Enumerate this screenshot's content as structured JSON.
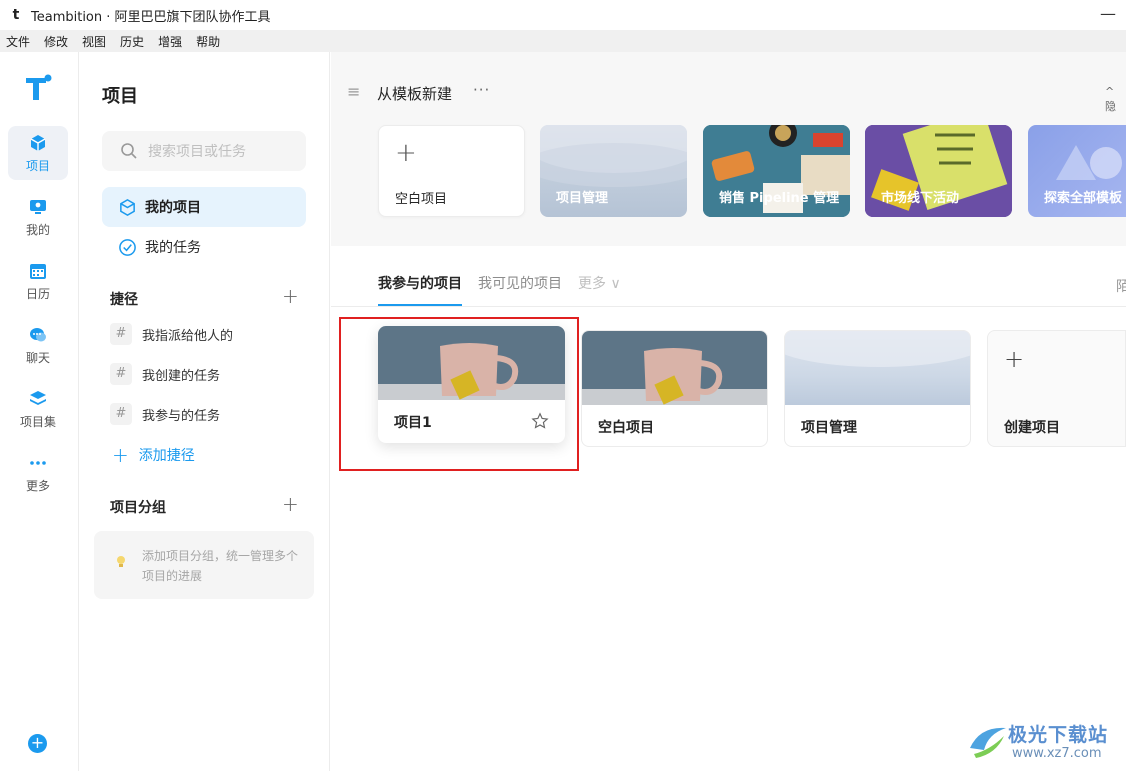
{
  "window": {
    "title": "Teambition · 阿里巴巴旗下团队协作工具",
    "logo_letter": "t",
    "minimize": "—"
  },
  "menu": [
    "文件",
    "修改",
    "视图",
    "历史",
    "增强",
    "帮助"
  ],
  "rail": {
    "items": [
      {
        "label": "项目",
        "icon": "cube-icon",
        "active": true
      },
      {
        "label": "我的",
        "icon": "monitor-icon"
      },
      {
        "label": "日历",
        "icon": "calendar-icon"
      },
      {
        "label": "聊天",
        "icon": "chat-icon"
      },
      {
        "label": "项目集",
        "icon": "layers-icon"
      },
      {
        "label": "更多",
        "icon": "more-dots-icon"
      }
    ],
    "add": "+"
  },
  "sidebar": {
    "title": "项目",
    "search_placeholder": "搜索项目或任务",
    "nav": [
      {
        "label": "我的项目",
        "active": true
      },
      {
        "label": "我的任务"
      }
    ],
    "shortcuts_heading": "捷径",
    "shortcuts": [
      "我指派给他人的",
      "我创建的任务",
      "我参与的任务"
    ],
    "hash": "#",
    "plus": "+",
    "add_shortcut": "添加捷径",
    "groups_heading": "项目分组",
    "groups_hint": "添加项目分组，统一管理多个项目的进展"
  },
  "templates": {
    "menu_icon": "≡",
    "title": "从模板新建",
    "more": "···",
    "hide": "^ 隐",
    "cards": [
      {
        "label": "空白项目"
      },
      {
        "label": "项目管理"
      },
      {
        "label": "销售 Pipeline 管理"
      },
      {
        "label": "市场线下活动"
      },
      {
        "label": "探索全部模板"
      }
    ]
  },
  "tabs": {
    "items": [
      "我参与的项目",
      "我可见的项目"
    ],
    "more": "更多 ∨",
    "right": "陌"
  },
  "projects": [
    {
      "name": "项目1",
      "starred": false
    },
    {
      "name": "空白项目"
    },
    {
      "name": "项目管理"
    },
    {
      "name": "创建项目"
    }
  ],
  "watermark": {
    "text": "极光下载站",
    "url": "www.xz7.com"
  },
  "colors": {
    "accent": "#1b9aee",
    "highlight": "#e02020"
  }
}
